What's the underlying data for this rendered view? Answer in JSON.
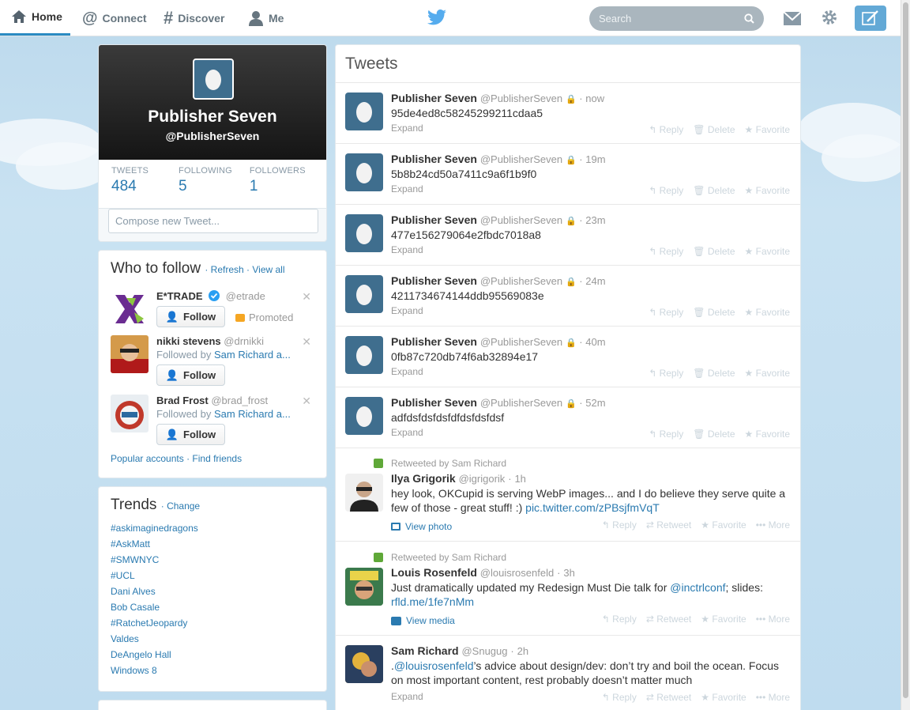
{
  "nav": {
    "home": "Home",
    "connect": "Connect",
    "discover": "Discover",
    "me": "Me"
  },
  "search": {
    "placeholder": "Search"
  },
  "profile": {
    "name": "Publisher Seven",
    "handle": "@PublisherSeven",
    "stats": [
      {
        "label": "TWEETS",
        "value": "484"
      },
      {
        "label": "FOLLOWING",
        "value": "5"
      },
      {
        "label": "FOLLOWERS",
        "value": "1"
      }
    ],
    "compose_placeholder": "Compose new Tweet..."
  },
  "who_to_follow": {
    "title": "Who to follow",
    "refresh": "Refresh",
    "view_all": "View all",
    "suggestions": [
      {
        "name": "E*TRADE",
        "handle": "@etrade",
        "follow": "Follow",
        "promoted": "Promoted"
      },
      {
        "name": "nikki stevens",
        "handle": "@drnikki",
        "followed_by": "Followed by",
        "followed_name": "Sam Richard a...",
        "follow": "Follow"
      },
      {
        "name": "Brad Frost",
        "handle": "@brad_frost",
        "followed_by": "Followed by",
        "followed_name": "Sam Richard a...",
        "follow": "Follow"
      }
    ],
    "popular": "Popular accounts",
    "find": "Find friends"
  },
  "trends": {
    "title": "Trends",
    "change": "Change",
    "items": [
      "#askimaginedragons",
      "#AskMatt",
      "#SMWNYC",
      "#UCL",
      "Dani Alves",
      "Bob Casale",
      "#RatchetJeopardy",
      "Valdes",
      "DeAngelo Hall",
      "Windows 8"
    ]
  },
  "stream": {
    "title": "Tweets",
    "own": [
      {
        "name": "Publisher Seven",
        "handle": "@PublisherSeven",
        "time": "now",
        "text": "95de4ed8c58245299211cdaa5"
      },
      {
        "name": "Publisher Seven",
        "handle": "@PublisherSeven",
        "time": "19m",
        "text": "5b8b24cd50a7411c9a6f1b9f0"
      },
      {
        "name": "Publisher Seven",
        "handle": "@PublisherSeven",
        "time": "23m",
        "text": "477e156279064e2fbdc7018a8"
      },
      {
        "name": "Publisher Seven",
        "handle": "@PublisherSeven",
        "time": "24m",
        "text": "4211734674144ddb95569083e"
      },
      {
        "name": "Publisher Seven",
        "handle": "@PublisherSeven",
        "time": "40m",
        "text": "0fb87c720db74f6ab32894e17"
      },
      {
        "name": "Publisher Seven",
        "handle": "@PublisherSeven",
        "time": "52m",
        "text": "adfdsfdsfdsfdfdsfdsfdsf"
      }
    ],
    "expand": "Expand",
    "reply": "Reply",
    "delete": "Delete",
    "favorite": "Favorite",
    "retweet": "Retweet",
    "more": "More",
    "t7": {
      "rt_by": "Retweeted by Sam Richard",
      "name": "Ilya Grigorik",
      "handle": "@igrigorik",
      "time": "1h",
      "text": "hey look, OKCupid is serving WebP images... and I do believe they serve quite a few of those - great stuff! :) ",
      "link": "pic.twitter.com/zPBsjfmVqT",
      "media": "View photo"
    },
    "t8": {
      "rt_by": "Retweeted by Sam Richard",
      "name": "Louis Rosenfeld",
      "handle": "@louisrosenfeld",
      "time": "3h",
      "text": "Just dramatically updated my Redesign Must Die talk for ",
      "mention": "@inctrlconf",
      "text2": "; slides:",
      "link": "rfld.me/1fe7nMm",
      "media": "View media"
    },
    "t9": {
      "name": "Sam Richard",
      "handle": "@Snugug",
      "time": "2h",
      "pre": ".",
      "mention": "@louisrosenfeld",
      "text": "’s advice about design/dev: don’t try and boil the ocean. Focus on most important content, rest probably doesn’t matter much"
    }
  },
  "colors": {
    "link": "#2a7ab0",
    "accent": "#63a9d6",
    "egg": "#3f6e8e"
  }
}
